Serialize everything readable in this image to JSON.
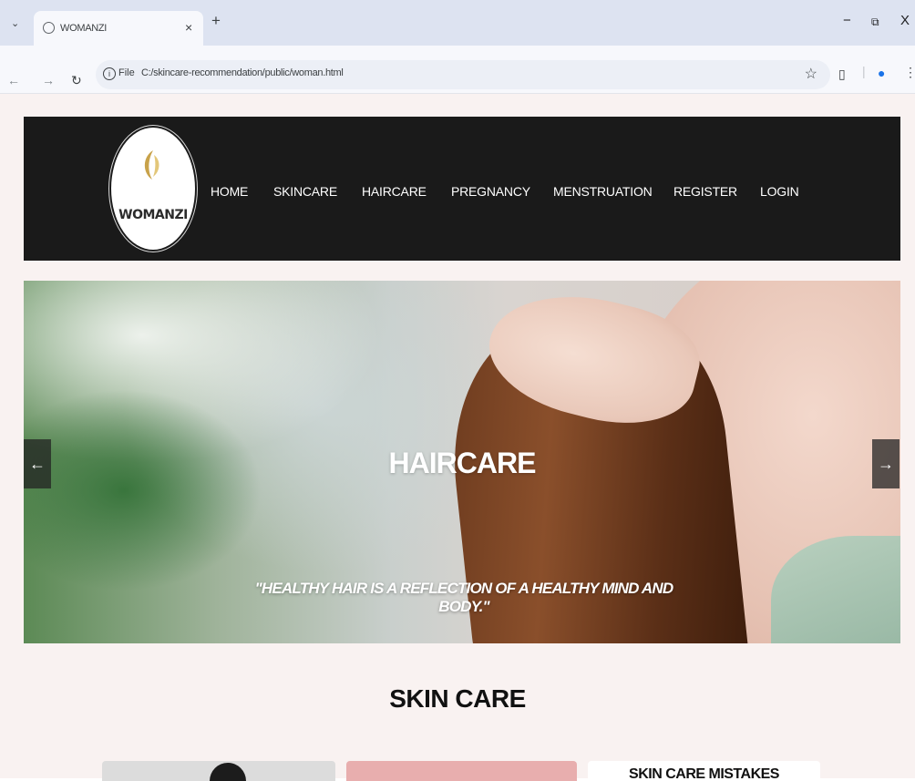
{
  "browser": {
    "tab_title": "WOMANZI",
    "tab_close": "×",
    "new_tab": "+",
    "tab_menu": "⌄",
    "file_label": "File",
    "url": "C:/skincare-recommendation/public/woman.html",
    "window_controls": {
      "minimize": "−",
      "restore": "⧉",
      "close": "X"
    }
  },
  "site": {
    "logo_text": "WOMANZI",
    "nav": [
      "HOME",
      "SKINCARE",
      "HAIRCARE",
      "PREGNANCY",
      "MENSTRUATION",
      "REGISTER",
      "LOGIN"
    ]
  },
  "hero": {
    "title": "HAIRCARE",
    "quote": "\"HEALTHY HAIR IS A REFLECTION OF A HEALTHY MIND AND BODY.\"",
    "prev": "←",
    "next": "→"
  },
  "skin_care": {
    "heading": "SKIN CARE",
    "card3_title": "SKIN CARE MISTAKES"
  },
  "colors": {
    "nav_background": "#1a1a1a",
    "page_background": "#f9f2f1",
    "card2": "#e8aeae"
  }
}
